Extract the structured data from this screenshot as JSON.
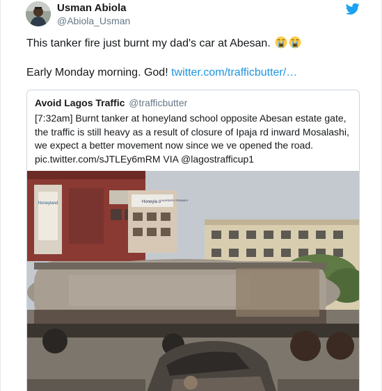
{
  "tweet": {
    "author_name": "Usman Abiola",
    "author_handle": "@Abiola_Usman",
    "text_line1": "This tanker fire just burnt my dad's car at Abesan.",
    "text_line2": "Early Monday morning. God!",
    "link": "twitter.com/trafficbutter/…",
    "emoji": "crying-face-emoji"
  },
  "quote": {
    "name": "Avoid Lagos Traffic",
    "handle": "@trafficbutter",
    "lines": [
      "[7:32am] Burnt tanker at honeyland school opposite Abesan estate gate,",
      "the traffic is still heavy as a result of closure of Ipaja rd inward Mosalashi,",
      "we expect a better movement now since we ve opened the road.",
      "pic.twitter.com/sJTLEy6mRM VIA @lagostrafficup1"
    ],
    "photo_signs": {
      "school_sign": "Honeyland",
      "banner": "Honeyland",
      "building_sign_left": "Honeyla d",
      "building_sign_right": "NURSERY PRIMARY"
    }
  },
  "colors": {
    "link": "#1b95e0",
    "twitter_blue": "#1da1f2",
    "secondary_text": "#657786",
    "border": "#ccd6dd"
  },
  "icons": {
    "brand": "twitter-bird-icon"
  }
}
